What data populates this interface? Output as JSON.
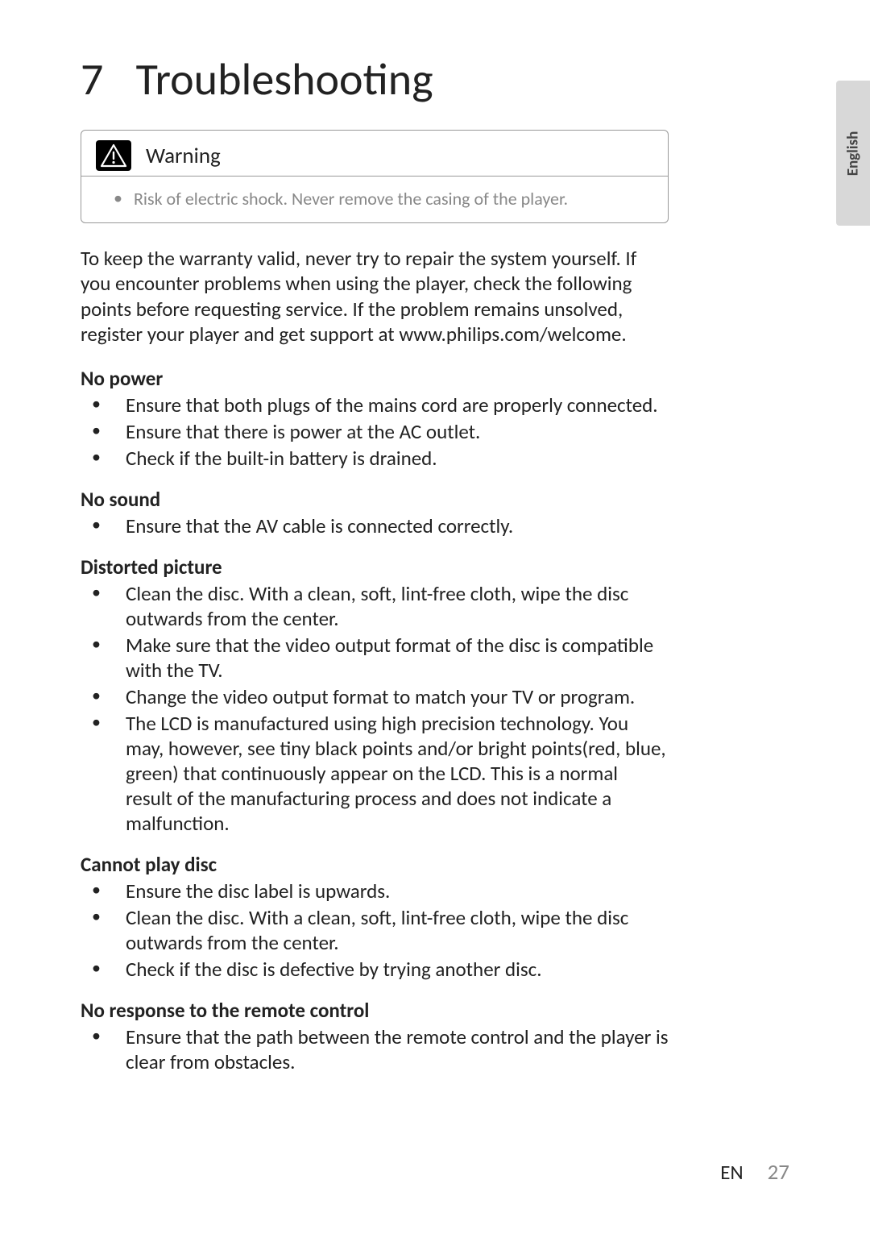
{
  "side_tab": "English",
  "chapter": {
    "number": "7",
    "title": "Troubleshooting"
  },
  "warning": {
    "label": "Warning",
    "text": "Risk of electric shock. Never remove the casing of the player."
  },
  "intro": "To keep the warranty valid, never try to repair the system yourself. If you encounter problems when using the player, check the following points before requesting service. If the problem remains unsolved, register your player and get support at www.philips.com/welcome.",
  "sections": [
    {
      "title": "No power",
      "items": [
        "Ensure that both plugs of the mains cord are properly connected.",
        "Ensure that there is power at the AC outlet.",
        "Check if the built-in battery is drained."
      ]
    },
    {
      "title": "No sound",
      "items": [
        "Ensure that the AV cable is connected correctly."
      ]
    },
    {
      "title": "Distorted picture",
      "items": [
        "Clean the disc. With a clean, soft, lint-free cloth, wipe the disc outwards from the center.",
        "Make sure that the video output format of the disc is compatible with the TV.",
        "Change the video output format to match your TV or program.",
        "The LCD is manufactured using high precision technology. You may, however, see tiny black points and/or bright points(red, blue, green) that continuously appear on the LCD. This is a normal result of the manufacturing process and does not indicate a malfunction."
      ]
    },
    {
      "title": "Cannot play disc",
      "items": [
        "Ensure the disc label is upwards.",
        "Clean the disc. With a clean, soft, lint-free cloth, wipe the disc outwards from the center.",
        "Check if the disc is defective by trying another disc."
      ]
    },
    {
      "title": "No response to the remote control",
      "items": [
        "Ensure that the path between the remote control and the player is clear from obstacles."
      ]
    }
  ],
  "footer": {
    "lang": "EN",
    "page": "27"
  }
}
